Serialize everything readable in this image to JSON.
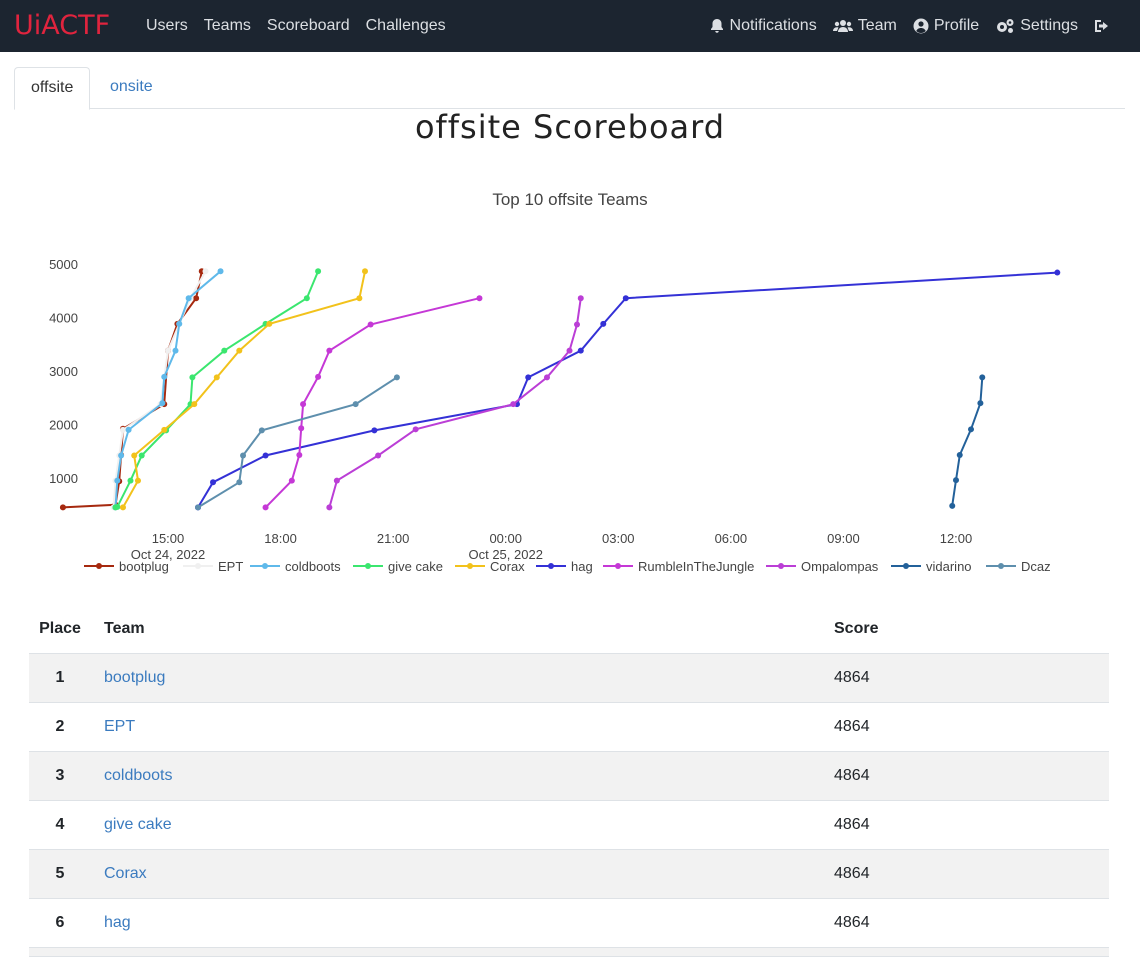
{
  "nav": {
    "brand": "UiACTF",
    "links": [
      "Users",
      "Teams",
      "Scoreboard",
      "Challenges"
    ],
    "right": [
      "Notifications",
      "Team",
      "Profile",
      "Settings"
    ]
  },
  "tabs": [
    "offsite",
    "onsite"
  ],
  "page_title": "offsite Scoreboard",
  "chart_data": {
    "type": "line",
    "title": "Top 10 offsite Teams",
    "x_axis": "time",
    "x_ticks": [
      {
        "label": "15:00",
        "sublabel": "Oct 24, 2022"
      },
      {
        "label": "18:00",
        "sublabel": ""
      },
      {
        "label": "21:00",
        "sublabel": ""
      },
      {
        "label": "00:00",
        "sublabel": "Oct 25, 2022"
      },
      {
        "label": "03:00",
        "sublabel": ""
      },
      {
        "label": "06:00",
        "sublabel": ""
      },
      {
        "label": "09:00",
        "sublabel": ""
      },
      {
        "label": "12:00",
        "sublabel": ""
      }
    ],
    "y_ticks": [
      1000,
      2000,
      3000,
      4000,
      5000
    ],
    "ylim": [
      400,
      5100
    ],
    "xlim_hours_note": "x values are hours relative to 2022-10-24 00:00",
    "series": [
      {
        "name": "bootplug",
        "color": "#a6290f",
        "points": [
          [
            12.2,
            450
          ],
          [
            13.6,
            500
          ],
          [
            13.7,
            940
          ],
          [
            13.75,
            1430
          ],
          [
            13.8,
            1920
          ],
          [
            14.9,
            2380
          ],
          [
            15.0,
            3380
          ],
          [
            15.25,
            3880
          ],
          [
            15.75,
            4360
          ],
          [
            15.9,
            4864
          ]
        ]
      },
      {
        "name": "EPT",
        "color": "#f0f0f0",
        "points": [
          [
            13.55,
            450
          ],
          [
            13.6,
            950
          ],
          [
            13.7,
            1420
          ],
          [
            13.8,
            1900
          ],
          [
            14.8,
            2380
          ],
          [
            15.0,
            3380
          ],
          [
            15.3,
            3880
          ],
          [
            15.6,
            4360
          ],
          [
            16.0,
            4864
          ]
        ]
      },
      {
        "name": "coldboots",
        "color": "#5fb9ea",
        "points": [
          [
            13.6,
            450
          ],
          [
            13.65,
            950
          ],
          [
            13.75,
            1420
          ],
          [
            13.95,
            1900
          ],
          [
            14.85,
            2400
          ],
          [
            14.9,
            2890
          ],
          [
            15.2,
            3380
          ],
          [
            15.3,
            3880
          ],
          [
            15.55,
            4360
          ],
          [
            16.4,
            4864
          ]
        ]
      },
      {
        "name": "give cake",
        "color": "#3be66f",
        "points": [
          [
            13.6,
            450
          ],
          [
            13.65,
            460
          ],
          [
            14.0,
            950
          ],
          [
            14.3,
            1420
          ],
          [
            14.95,
            1890
          ],
          [
            15.6,
            2380
          ],
          [
            15.65,
            2880
          ],
          [
            16.5,
            3380
          ],
          [
            17.6,
            3880
          ],
          [
            18.7,
            4360
          ],
          [
            19.0,
            4864
          ]
        ]
      },
      {
        "name": "Corax",
        "color": "#f2c21b",
        "points": [
          [
            13.8,
            450
          ],
          [
            14.2,
            950
          ],
          [
            14.1,
            1420
          ],
          [
            14.9,
            1900
          ],
          [
            15.7,
            2380
          ],
          [
            16.3,
            2880
          ],
          [
            16.9,
            3380
          ],
          [
            17.7,
            3880
          ],
          [
            20.1,
            4360
          ],
          [
            20.25,
            4864
          ]
        ]
      },
      {
        "name": "hag",
        "color": "#3431d6",
        "points": [
          [
            15.8,
            450
          ],
          [
            16.2,
            920
          ],
          [
            17.6,
            1420
          ],
          [
            20.5,
            1890
          ],
          [
            24.3,
            2380
          ],
          [
            24.6,
            2880
          ],
          [
            26.0,
            3380
          ],
          [
            26.6,
            3880
          ],
          [
            27.2,
            4360
          ],
          [
            38.7,
            4840
          ]
        ]
      },
      {
        "name": "RumbleInTheJungle",
        "color": "#c538d6",
        "points": [
          [
            17.6,
            450
          ],
          [
            18.3,
            950
          ],
          [
            18.5,
            1430
          ],
          [
            18.55,
            1930
          ],
          [
            18.6,
            2380
          ],
          [
            19.0,
            2890
          ],
          [
            19.3,
            3380
          ],
          [
            20.4,
            3870
          ],
          [
            23.3,
            4360
          ]
        ]
      },
      {
        "name": "Ompalompas",
        "color": "#bb3ed6",
        "points": [
          [
            19.3,
            450
          ],
          [
            19.5,
            950
          ],
          [
            20.6,
            1420
          ],
          [
            21.6,
            1910
          ],
          [
            24.2,
            2380
          ],
          [
            25.1,
            2880
          ],
          [
            25.7,
            3380
          ],
          [
            25.9,
            3870
          ],
          [
            26.0,
            4360
          ]
        ]
      },
      {
        "name": "vidarino",
        "color": "#23619a",
        "points": [
          [
            35.9,
            480
          ],
          [
            36.0,
            960
          ],
          [
            36.1,
            1430
          ],
          [
            36.4,
            1910
          ],
          [
            36.65,
            2400
          ],
          [
            36.7,
            2880
          ]
        ]
      },
      {
        "name": "Dcaz",
        "color": "#5e8fad",
        "points": [
          [
            15.8,
            450
          ],
          [
            16.9,
            920
          ],
          [
            17.0,
            1420
          ],
          [
            17.5,
            1890
          ],
          [
            20.0,
            2380
          ],
          [
            21.1,
            2880
          ]
        ]
      }
    ]
  },
  "table": {
    "headers": [
      "Place",
      "Team",
      "Score"
    ],
    "rows": [
      {
        "place": "1",
        "team": "bootplug",
        "score": "4864"
      },
      {
        "place": "2",
        "team": "EPT",
        "score": "4864"
      },
      {
        "place": "3",
        "team": "coldboots",
        "score": "4864"
      },
      {
        "place": "4",
        "team": "give cake",
        "score": "4864"
      },
      {
        "place": "5",
        "team": "Corax",
        "score": "4864"
      },
      {
        "place": "6",
        "team": "hag",
        "score": "4864"
      }
    ]
  }
}
